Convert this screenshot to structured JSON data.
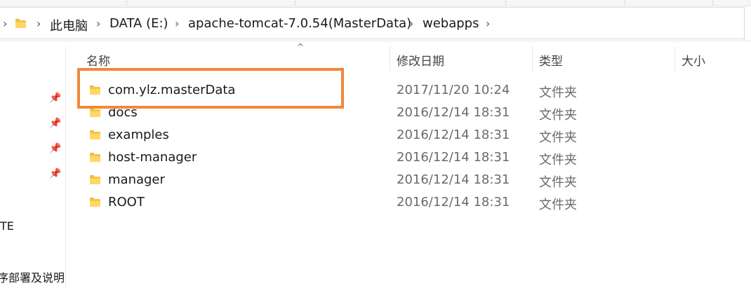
{
  "breadcrumb": {
    "items": [
      "此电脑",
      "DATA (E:)",
      "apache-tomcat-7.0.54(MasterData)",
      "webapps"
    ],
    "separator": ">"
  },
  "left_pane": {
    "label_1": "TE",
    "label_2": "序部署及说明"
  },
  "columns": {
    "name": "名称",
    "date": "修改日期",
    "type": "类型",
    "size": "大小"
  },
  "files": [
    {
      "name": "com.ylz.masterData",
      "date": "2017/11/20 10:24",
      "type": "文件夹",
      "icon": "folder-icon"
    },
    {
      "name": "docs",
      "date": "2016/12/14 18:31",
      "type": "文件夹",
      "icon": "folder-icon"
    },
    {
      "name": "examples",
      "date": "2016/12/14 18:31",
      "type": "文件夹",
      "icon": "folder-icon"
    },
    {
      "name": "host-manager",
      "date": "2016/12/14 18:31",
      "type": "文件夹",
      "icon": "folder-icon"
    },
    {
      "name": "manager",
      "date": "2016/12/14 18:31",
      "type": "文件夹",
      "icon": "folder-icon"
    },
    {
      "name": "ROOT",
      "date": "2016/12/14 18:31",
      "type": "文件夹",
      "icon": "folder-icon"
    }
  ],
  "colors": {
    "highlight": "#f0883a",
    "folder": "#f4c543"
  }
}
